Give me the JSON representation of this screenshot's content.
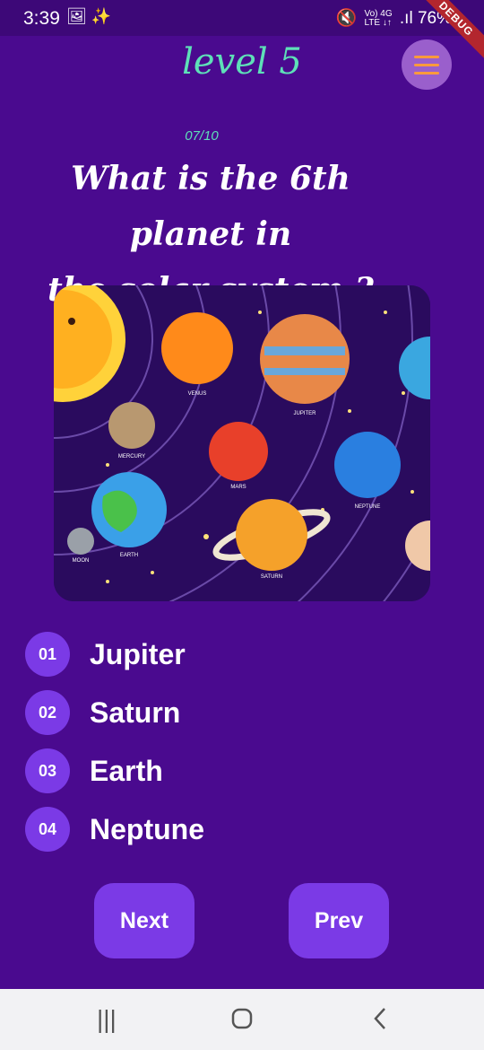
{
  "status": {
    "time": "3:39",
    "left_icons": "🖼 ✨",
    "signal": "Vo) 4G",
    "signal_sub": "LTE ↓↑",
    "battery": "76%",
    "debug": "DEBUG"
  },
  "header": {
    "title": "level 5",
    "menu_icon": "hamburger-icon",
    "menu_color": "#ff9a3c"
  },
  "quiz": {
    "progress": "07/10",
    "question_line1": "What is the 6th planet in",
    "question_line2": "the solar system ?",
    "image_labels": {
      "venus": "VENUS",
      "jupiter": "JUPITER",
      "mercury": "MERCURY",
      "mars": "MARS",
      "neptune": "NEPTUNE",
      "earth": "EARTH",
      "moon": "MOON",
      "saturn": "SATURN"
    },
    "answers": [
      {
        "num": "01",
        "label": "Jupiter"
      },
      {
        "num": "02",
        "label": "Saturn"
      },
      {
        "num": "03",
        "label": "Earth"
      },
      {
        "num": "04",
        "label": "Neptune"
      }
    ]
  },
  "buttons": {
    "next": "Next",
    "prev": "Prev"
  },
  "colors": {
    "background": "#4a0a8f",
    "accent": "#7b3ae6",
    "title": "#5ee0b8"
  }
}
